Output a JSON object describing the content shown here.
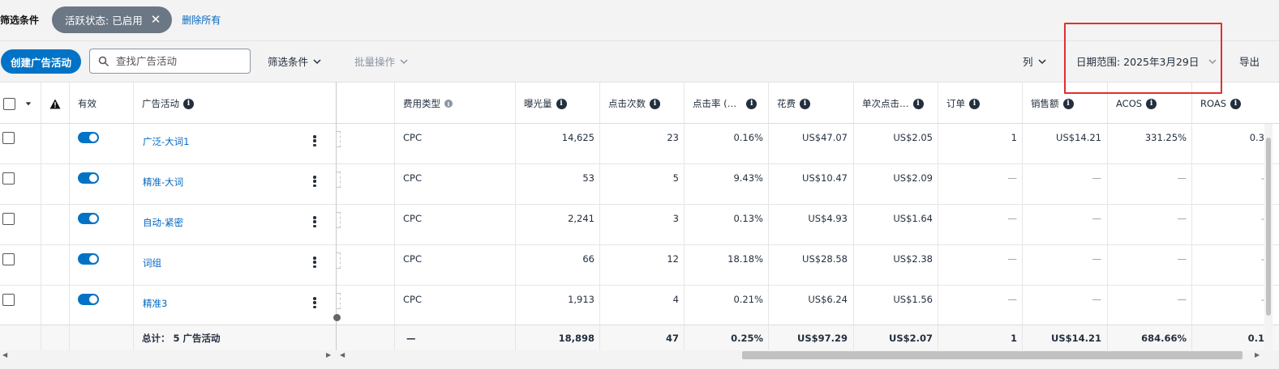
{
  "filter_bar": {
    "title": "筛选条件",
    "chip_label": "活跃状态: 已启用",
    "remove_all": "删除所有"
  },
  "toolbar": {
    "create_label": "创建广告活动",
    "search_placeholder": "查找广告活动",
    "filter_label": "筛选条件",
    "bulk_label": "批量操作",
    "columns_label": "列",
    "date_label": "日期范围: 2025年3月29日",
    "export_label": "导出"
  },
  "table": {
    "headers": {
      "valid": "有效",
      "campaign": "广告活动",
      "cost_type": "费用类型",
      "impressions": "曝光量",
      "clicks": "点击次数",
      "ctr": "点击率 (…",
      "spend": "花费",
      "cpc": "单次点击…",
      "orders": "订单",
      "sales": "销售额",
      "acos": "ACOS",
      "roas": "ROAS"
    },
    "rows": [
      {
        "campaign": "广泛-大词1",
        "cost_type": "CPC",
        "impressions": "14,625",
        "clicks": "23",
        "ctr": "0.16%",
        "spend": "US$47.07",
        "cpc": "US$2.05",
        "orders": "1",
        "sales": "US$14.21",
        "acos": "331.25%",
        "roas": "0.3"
      },
      {
        "campaign": "精准-大词",
        "cost_type": "CPC",
        "impressions": "53",
        "clicks": "5",
        "ctr": "9.43%",
        "spend": "US$10.47",
        "cpc": "US$2.09",
        "orders": "—",
        "sales": "—",
        "acos": "—",
        "roas": "-"
      },
      {
        "campaign": "自动-紧密",
        "cost_type": "CPC",
        "impressions": "2,241",
        "clicks": "3",
        "ctr": "0.13%",
        "spend": "US$4.93",
        "cpc": "US$1.64",
        "orders": "—",
        "sales": "—",
        "acos": "—",
        "roas": "-"
      },
      {
        "campaign": "词组",
        "cost_type": "CPC",
        "impressions": "66",
        "clicks": "12",
        "ctr": "18.18%",
        "spend": "US$28.58",
        "cpc": "US$2.38",
        "orders": "—",
        "sales": "—",
        "acos": "—",
        "roas": "-"
      },
      {
        "campaign": "精准3",
        "cost_type": "CPC",
        "impressions": "1,913",
        "clicks": "4",
        "ctr": "0.21%",
        "spend": "US$6.24",
        "cpc": "US$1.56",
        "orders": "—",
        "sales": "—",
        "acos": "—",
        "roas": "-"
      }
    ],
    "total": {
      "label": "总计： 5 广告活动",
      "cost_type": "—",
      "impressions": "18,898",
      "clicks": "47",
      "ctr": "0.25%",
      "spend": "US$97.29",
      "cpc": "US$2.07",
      "orders": "1",
      "sales": "US$14.21",
      "acos": "684.66%",
      "roas": "0.1"
    }
  },
  "colors": {
    "primary": "#0073c7",
    "chip": "#6b7785",
    "highlight": "#e0302f",
    "link": "#0066c0"
  },
  "icons": [
    "close-icon",
    "search-icon",
    "chevron-down-icon",
    "warning-icon",
    "info-icon",
    "kebab-menu-icon",
    "toggle-switch"
  ]
}
